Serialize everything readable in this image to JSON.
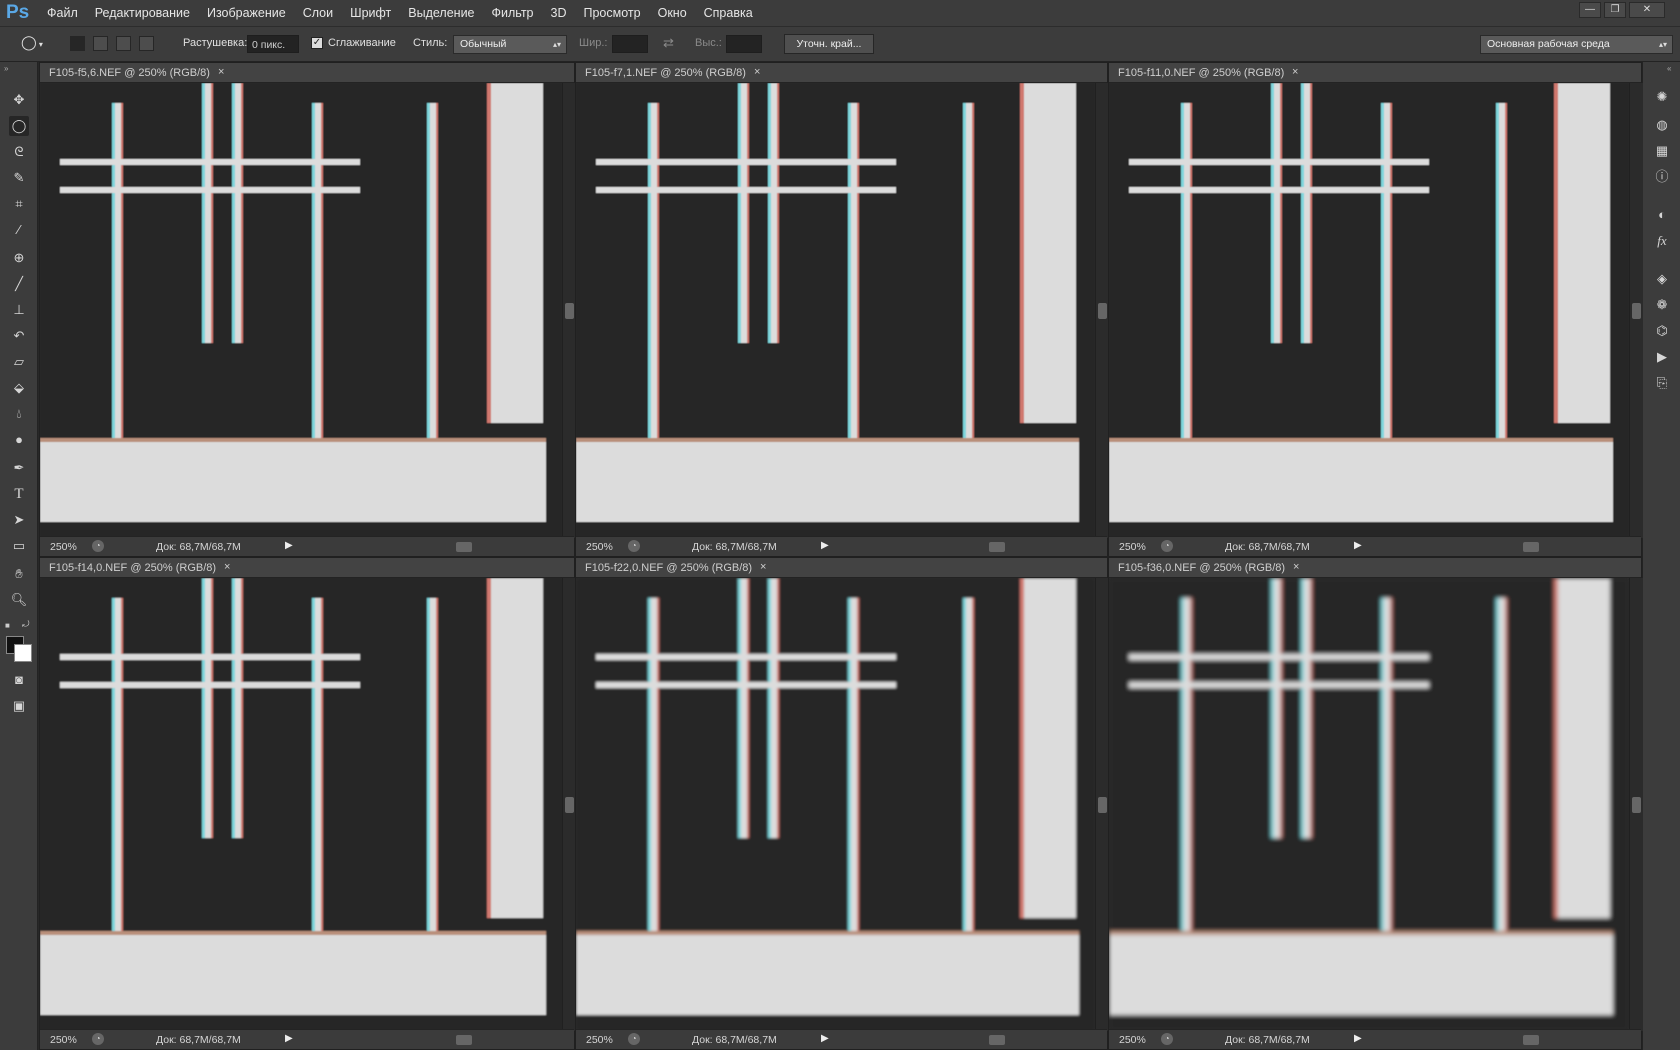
{
  "app": {
    "logo": "Ps",
    "window_buttons": [
      "—",
      "❐",
      "✕"
    ]
  },
  "menu": [
    "Файл",
    "Редактирование",
    "Изображение",
    "Слои",
    "Шрифт",
    "Выделение",
    "Фильтр",
    "3D",
    "Просмотр",
    "Окно",
    "Справка"
  ],
  "options": {
    "feather_label": "Растушевка:",
    "feather_value": "0 пикс.",
    "antialias_label": "Сглаживание",
    "style_label": "Стиль:",
    "style_value": "Обычный",
    "width_label": "Шир.:",
    "height_label": "Выс.:",
    "refine_edge": "Уточн. край...",
    "workspace": "Основная рабочая среда"
  },
  "tools": [
    "move-tool",
    "elliptical-marquee-tool",
    "lasso-tool",
    "quick-selection-tool",
    "crop-tool",
    "eyedropper-tool",
    "spot-healing-tool",
    "brush-tool",
    "clone-stamp-tool",
    "history-brush-tool",
    "eraser-tool",
    "paint-bucket-tool",
    "blur-tool",
    "dodge-tool",
    "pen-tool",
    "type-tool",
    "path-selection-tool",
    "rectangle-tool",
    "hand-tool",
    "zoom-tool"
  ],
  "panel_icons": [
    "color-icon",
    "swatches-icon",
    "grid-icon",
    "info-icon",
    "adjustments-icon",
    "styles-icon",
    "layers-icon",
    "channels-icon",
    "paths-icon",
    "actions-icon",
    "history-icon"
  ],
  "documents": [
    {
      "title": "F105-f5,6.NEF @ 250% (RGB/8)",
      "zoom": "250%",
      "doc": "Док: 68,7M/68,7M"
    },
    {
      "title": "F105-f7,1.NEF @ 250% (RGB/8)",
      "zoom": "250%",
      "doc": "Док: 68,7M/68,7M"
    },
    {
      "title": "F105-f11,0.NEF @ 250% (RGB/8)",
      "zoom": "250%",
      "doc": "Док: 68,7M/68,7M"
    },
    {
      "title": "F105-f14,0.NEF @ 250% (RGB/8)",
      "zoom": "250%",
      "doc": "Док: 68,7M/68,7M"
    },
    {
      "title": "F105-f22,0.NEF @ 250% (RGB/8)",
      "zoom": "250%",
      "doc": "Док: 68,7M/68,7M"
    },
    {
      "title": "F105-f36,0.NEF @ 250% (RGB/8)",
      "zoom": "250%",
      "doc": "Док: 68,7M/68,7M"
    }
  ],
  "colors": {
    "chrome": "#3c3c3c",
    "canvas_dark": "#262626",
    "target_light": "#dcdcdc",
    "fringe_cyan": "#7fd6dc",
    "fringe_red": "#d0786e"
  }
}
